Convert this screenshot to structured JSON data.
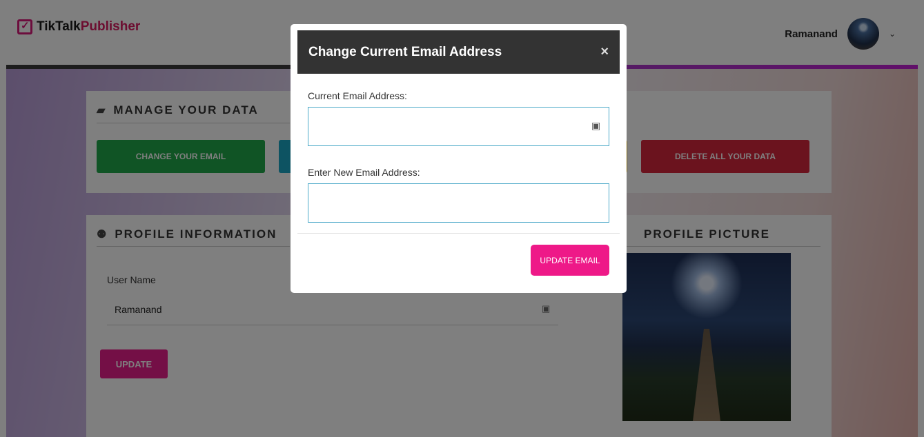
{
  "brand": {
    "part1": "TikTalk",
    "part2": "Publisher"
  },
  "user": {
    "name": "Ramanand"
  },
  "manage": {
    "title": "MANAGE YOUR DATA",
    "change_email_label": "CHANGE YOUR EMAIL",
    "delete_label": "DELETE ALL YOUR DATA"
  },
  "profile": {
    "title": "PROFILE INFORMATION",
    "username_label": "User Name",
    "username_value": "Ramanand",
    "update_label": "UPDATE",
    "picture_title": "PROFILE PICTURE"
  },
  "modal": {
    "title": "Change Current Email Address",
    "close": "×",
    "current_label": "Current Email Address:",
    "current_value": "",
    "new_label": "Enter New Email Address:",
    "new_value": "",
    "submit_label": "UPDATE EMAIL"
  },
  "colors": {
    "brand_pink": "#d81b60",
    "green": "#21a84a",
    "red": "#d7263d",
    "update_pink": "#e91e8c",
    "modal_header": "#333333"
  }
}
